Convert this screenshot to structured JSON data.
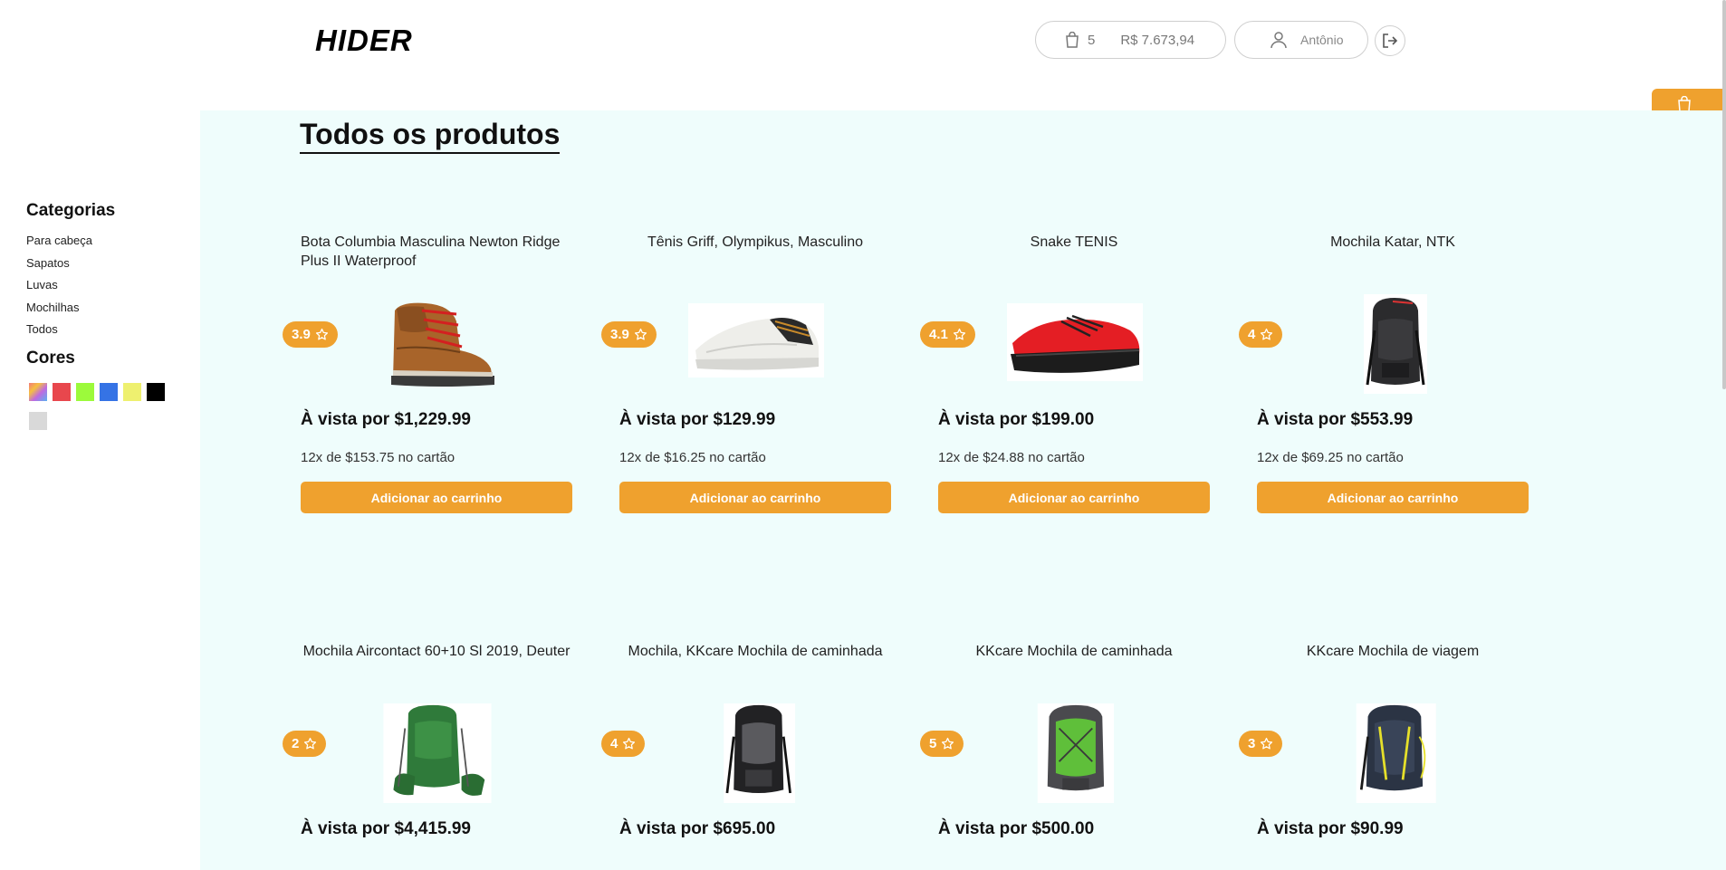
{
  "header": {
    "logo": "HIDER",
    "cart_count": "5",
    "cart_total": "R$ 7.673,94",
    "user_name": "Antônio"
  },
  "sidebar": {
    "categories_title": "Categorias",
    "categories": [
      "Para cabeça",
      "Sapatos",
      "Luvas",
      "Mochilhas",
      "Todos"
    ],
    "colors_title": "Cores",
    "colors": [
      "multicolor",
      "#e8474d",
      "#9cfa3b",
      "#3573e5",
      "#eef06f",
      "#000000",
      "#d9d9d9"
    ]
  },
  "main": {
    "title": "Todos os produtos",
    "add_to_cart_label": "Adicionar ao carrinho",
    "products": [
      {
        "name": "Bota Columbia Masculina Newton Ridge Plus II Waterproof",
        "rating": "3.9",
        "price": "À vista por $1,229.99",
        "installments": "12x de $153.75 no cartão",
        "image": "brown-boot"
      },
      {
        "name": "Tênis Griff, Olympikus, Masculino",
        "rating": "3.9",
        "price": "À vista por $129.99",
        "installments": "12x de $16.25 no cartão",
        "image": "white-sneaker"
      },
      {
        "name": "Snake TENIS",
        "rating": "4.1",
        "price": "À vista por $199.00",
        "installments": "12x de $24.88 no cartão",
        "image": "red-water-shoe"
      },
      {
        "name": "Mochila Katar, NTK",
        "rating": "4",
        "price": "À vista por $553.99",
        "installments": "12x de $69.25 no cartão",
        "image": "black-backpack"
      },
      {
        "name": "Mochila Aircontact 60+10 Sl 2019, Deuter",
        "rating": "2",
        "price": "À vista por $4,415.99",
        "installments": "",
        "image": "green-backpack"
      },
      {
        "name": "Mochila, KKcare Mochila de caminhada",
        "rating": "4",
        "price": "À vista por $695.00",
        "installments": "",
        "image": "black-grey-backpack"
      },
      {
        "name": "KKcare Mochila de caminhada",
        "rating": "5",
        "price": "À vista por $500.00",
        "installments": "",
        "image": "lime-backpack"
      },
      {
        "name": "KKcare Mochila de viagem",
        "rating": "3",
        "price": "À vista por $90.99",
        "installments": "",
        "image": "navy-yellow-backpack"
      }
    ]
  }
}
